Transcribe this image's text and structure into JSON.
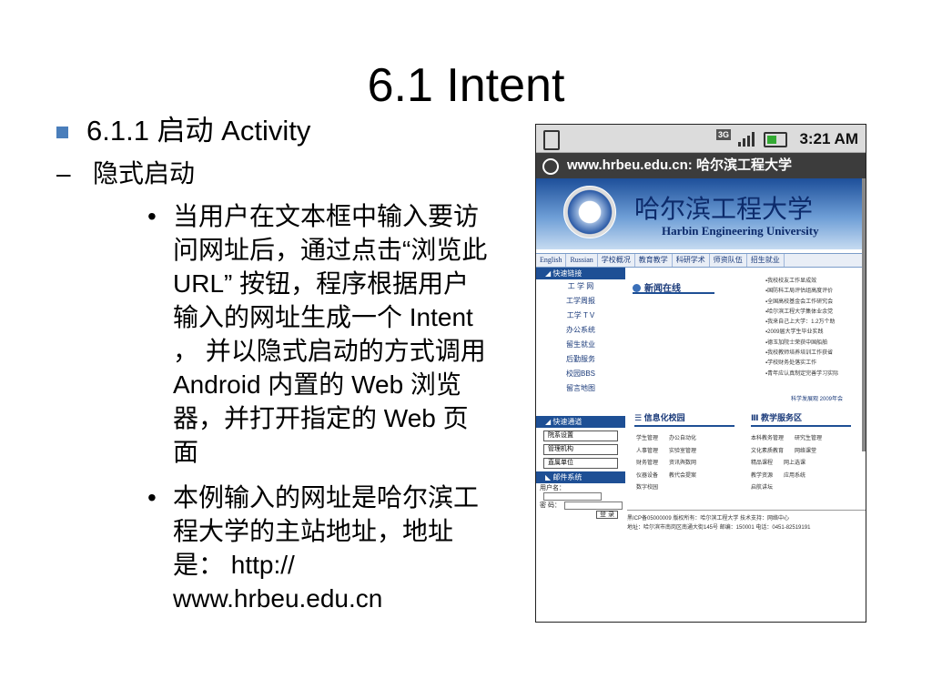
{
  "slide": {
    "title": "6.1  Intent",
    "level1": "6.1.1  启动 Activity",
    "level2_dash": "–",
    "level2": "隐式启动",
    "bullet_glyph": "•",
    "bullets": [
      "当用户在文本框中输入要访问网址后，通过点击“浏览此 URL” 按钮，程序根据用户输入的网址生成一个 Intent ， 并以隐式启动的方式调用 Android 内置的 Web 浏览器，并打开指定的 Web 页面",
      "本例输入的网址是哈尔滨工程大学的主站地址，地址是： http:// www.hrbeu.edu.cn"
    ]
  },
  "phone": {
    "status": {
      "network": "3G",
      "time": "3:21 AM"
    },
    "urlbar": "www.hrbeu.edu.cn: 哈尔滨工程大学",
    "site": {
      "cn_name": "哈尔滨工程大学",
      "en_name": "Harbin Engineering University",
      "nav": [
        "English",
        "Russian",
        "学校概况",
        "教育教学",
        "科研学术",
        "师资队伍",
        "招生就业"
      ],
      "left_head_1": "◢ 快速链接",
      "left_items": [
        "工 学 网",
        "工学周报",
        "工学 T V",
        "办公系统",
        "留生就业",
        "后勤服务",
        "校园BBS",
        "留言地图"
      ],
      "left_head_2": "◢ 快速通道",
      "left_buttons": [
        "院系设置",
        "管理机构",
        "直属单位"
      ],
      "left_head_3": "◣ 邮件系统",
      "login_labels": [
        "用户名：",
        "密 码："
      ],
      "login_button": "登 录",
      "news_title": "新闻在线",
      "news": [
        "▪我校校友工作显成效",
        "▪国防科工局评估组高度评价",
        "▪全国高校基金会工作研究会",
        "▪哈尔滨工程大学集体业余党",
        "▪我来自己上大学：1.2万个助",
        "▪2009届大学生毕业实践",
        "▪德玉加院士荣获中国船舶",
        "▪我校教师培养培训工作获省",
        "▪学校财务处落实工作",
        "▪青年应认真制定完善学习实际"
      ],
      "news_more": "科学发展观 2009年会",
      "sec1_title": "☰ 信息化校园",
      "sec2_title": "Ⅲ 教学服务区",
      "sec1_rows": [
        [
          "学生管理",
          "办公自动化"
        ],
        [
          "人事管理",
          "实验室管理"
        ],
        [
          "财务管理",
          "资讯舆数网"
        ],
        [
          "仪器设备",
          "教代会提案"
        ],
        [
          "数字校园",
          ""
        ]
      ],
      "sec2_rows": [
        [
          "本科教务管理",
          "研究生管理"
        ],
        [
          "文化素质教育",
          "网络课堂"
        ],
        [
          "精品课程",
          "网上选课"
        ],
        [
          "教学资源",
          "应用系统"
        ],
        [
          "启航讲坛",
          ""
        ]
      ],
      "footer": [
        "黑ICP备05000009   版权所有：哈尔滨工程大学   技术支持：网络中心",
        "地址：哈尔滨市南岗区南通大街145号   邮编：150001   电话：0451-82519191"
      ]
    }
  }
}
